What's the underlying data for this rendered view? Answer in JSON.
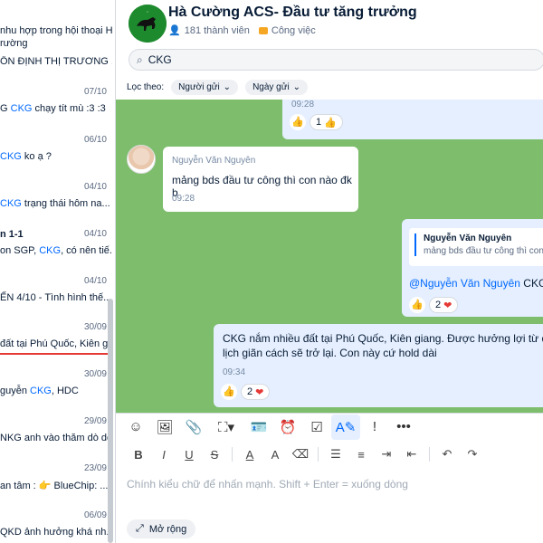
{
  "left_panel": {
    "items": [
      {
        "date": "",
        "lines": [
          "nhu hợp trong hội thoại Hà",
          "rường"
        ]
      },
      {
        "date": "",
        "lines": [
          "ỔN ĐỊNH THỊ TRƯƠNG ..."
        ]
      },
      {
        "date": "07/10",
        "pre": "G ",
        "hl": "CKG",
        "post": " chạy tít mù :3 :3"
      },
      {
        "date": "06/10",
        "pre": "",
        "hl": "CKG",
        "post": " ko ạ ?"
      },
      {
        "date": "04/10",
        "pre": "",
        "hl": "CKG",
        "post": " trạng thái hôm na..."
      },
      {
        "date": "04/10",
        "title": "n 1-1",
        "pre": "on SGP, ",
        "hl": "CKG",
        "post": ", có nên tiế..."
      },
      {
        "date": "04/10",
        "pre": "ẾN 4/10 - Tình hình thế...",
        "hl": "",
        "post": ""
      },
      {
        "date": "30/09",
        "pre": "đất tại Phú Quốc, Kiên g...",
        "hl": "",
        "post": ""
      },
      {
        "date": "30/09",
        "pre": "guyễn ",
        "hl": "CKG",
        "post": ", HDC"
      },
      {
        "date": "29/09",
        "pre": "NKG anh vào thăm dò dc",
        "hl": "",
        "post": ""
      },
      {
        "date": "23/09",
        "pre": "an tâm : 👉 BlueChip: ...",
        "hl": "",
        "post": ""
      },
      {
        "date": "06/09",
        "pre": "QKD ảnh hưởng khá nh...",
        "hl": "",
        "post": ""
      }
    ]
  },
  "header": {
    "title": "Hà Cường ACS- Đầu tư tăng trưởng",
    "members": "181 thành viên",
    "tag": "Công việc"
  },
  "search": {
    "value": "CKG"
  },
  "filter": {
    "label": "Lọc theo:",
    "sender": "Người gửi",
    "date": "Ngày gửi"
  },
  "messages": {
    "top": {
      "time": "09:28",
      "reaction_count": "1"
    },
    "m1": {
      "sender": "Nguyễn Văn Nguyên",
      "text": "mảng bds đầu tư công thì con nào đk b",
      "time": "09:28"
    },
    "m2": {
      "quote_sender": "Nguyễn Văn Nguyên",
      "quote_text": "mảng bds đầu tư công thì con nào đk b",
      "mention": "@Nguyễn Văn Nguyên",
      "text": " CKG, H",
      "reaction_count": "2"
    },
    "m3": {
      "text": "CKG nắm nhiều đất tại Phú Quốc, Kiên giang. Được hưởng lợi từ du lịch giãn cách sẽ trở lại. Con này cứ hold dài",
      "time": "09:34",
      "reaction_count": "2"
    }
  },
  "composer": {
    "placeholder": "Chính kiểu chữ để nhấn mạnh. Shift + Enter = xuống dòng",
    "expand": "Mở rộng"
  },
  "colors": {
    "accent": "#0068ff",
    "chat_bg": "#7dbd6c",
    "highlight_border": "#e53935"
  }
}
